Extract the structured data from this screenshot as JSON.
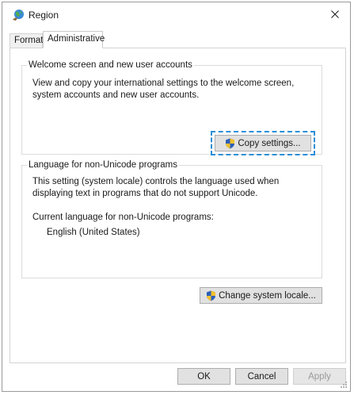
{
  "window": {
    "title": "Region",
    "icon": "globe-region-icon"
  },
  "tabs": [
    {
      "label": "Formats",
      "selected": false
    },
    {
      "label": "Administrative",
      "selected": true
    }
  ],
  "welcome_group": {
    "legend": "Welcome screen and new user accounts",
    "description": "View and copy your international settings to the welcome screen, system accounts and new user accounts.",
    "button_label": "Copy settings...",
    "button_icon": "uac-shield-icon"
  },
  "unicode_group": {
    "legend": "Language for non-Unicode programs",
    "description": "This setting (system locale) controls the language used when displaying text in programs that do not support Unicode.",
    "current_label": "Current language for non-Unicode programs:",
    "current_value": "English (United States)",
    "button_label": "Change system locale...",
    "button_icon": "uac-shield-icon"
  },
  "footer": {
    "ok_label": "OK",
    "cancel_label": "Cancel",
    "apply_label": "Apply",
    "apply_enabled": false
  },
  "colors": {
    "focus_ring": "#2b8fd6",
    "button_face": "#e1e1e1",
    "disabled_text": "#9a9a9a"
  }
}
